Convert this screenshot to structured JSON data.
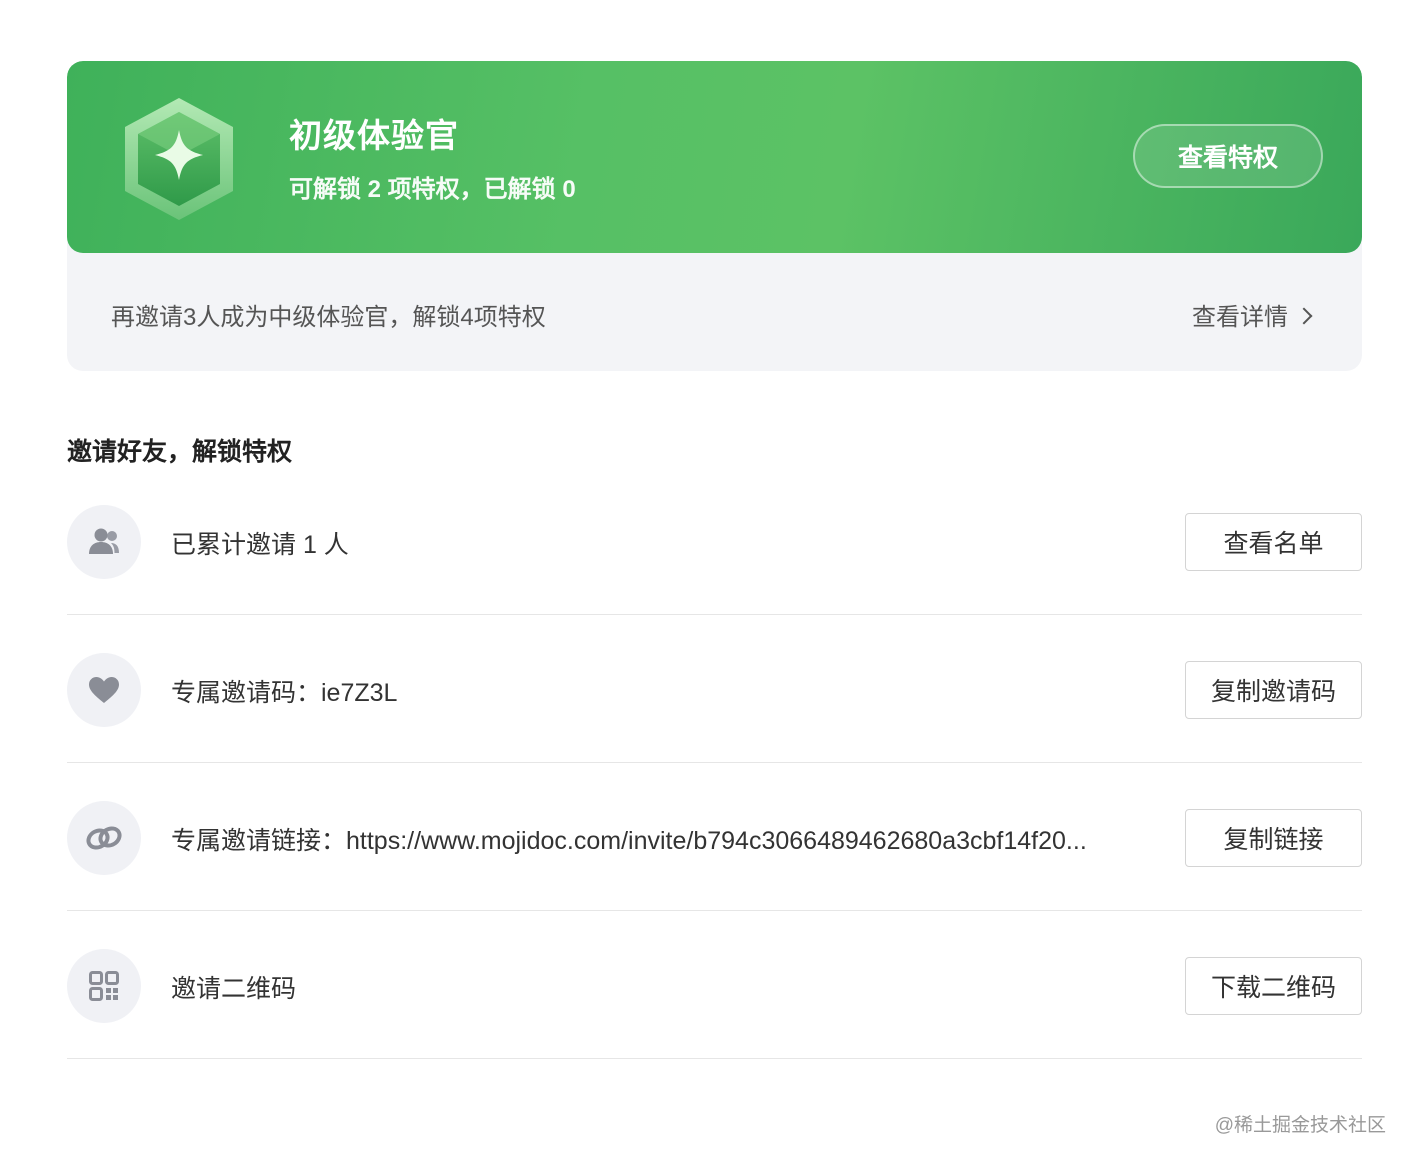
{
  "level": {
    "title": "初级体验官",
    "subtitle": "可解锁 2 项特权，已解锁 0",
    "privilege_button": "查看特权",
    "upgrade_hint": "再邀请3人成为中级体验官，解锁4项特权",
    "details_link": "查看详情"
  },
  "invite": {
    "section_title": "邀请好友，解锁特权",
    "rows": [
      {
        "icon": "users-icon",
        "text": "已累计邀请 1 人",
        "button": "查看名单"
      },
      {
        "icon": "heart-icon",
        "text": "专属邀请码：ie7Z3L",
        "button": "复制邀请码"
      },
      {
        "icon": "link-icon",
        "text": "专属邀请链接：https://www.mojidoc.com/invite/b794c3066489462680a3cbf14f20...",
        "button": "复制链接"
      },
      {
        "icon": "qrcode-icon",
        "text": "邀请二维码",
        "button": "下载二维码"
      }
    ]
  },
  "watermark": "@稀土掘金技术社区",
  "colors": {
    "banner_green": "#4cb95f",
    "icon_gray": "#8a8d96"
  }
}
